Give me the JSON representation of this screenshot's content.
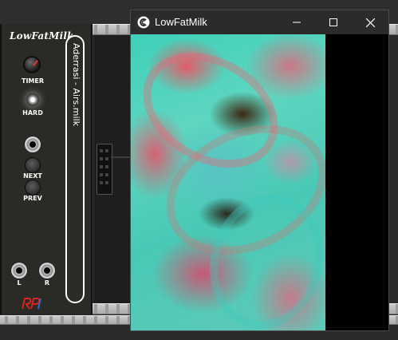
{
  "window": {
    "title": "LowFatMilk",
    "controls": {
      "minimize": "minimize",
      "maximize": "maximize",
      "close": "close"
    }
  },
  "module": {
    "title": "LowFatMilk",
    "knob_label": "TIMER",
    "led_label": "HARD",
    "next_label": "NEXT",
    "prev_label": "PREV",
    "left_label": "L",
    "right_label": "R",
    "preset_name": "Aderrasi - Airs.milk"
  },
  "colors": {
    "panel": "#2a2a26",
    "accent_teal": "#3fd0b8",
    "accent_pink": "#ff4a6a"
  }
}
